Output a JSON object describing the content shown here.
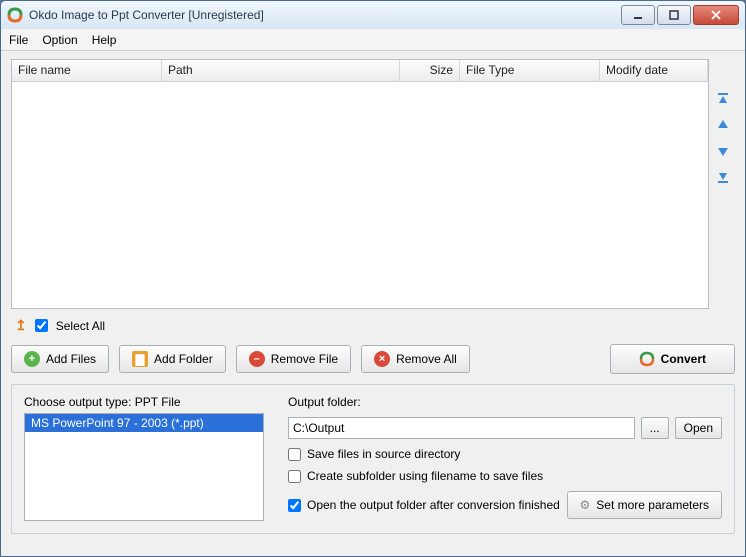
{
  "window": {
    "title": "Okdo Image to Ppt Converter [Unregistered]"
  },
  "menu": {
    "file": "File",
    "option": "Option",
    "help": "Help"
  },
  "columns": {
    "filename": "File name",
    "path": "Path",
    "size": "Size",
    "filetype": "File Type",
    "modify": "Modify date"
  },
  "selectAll": {
    "label": "Select All",
    "checked": true
  },
  "actions": {
    "addFiles": "Add Files",
    "addFolder": "Add Folder",
    "removeFile": "Remove File",
    "removeAll": "Remove All",
    "convert": "Convert"
  },
  "output": {
    "chooseLabel": "Choose output type:",
    "chooseValue": "PPT File",
    "listSelected": "MS PowerPoint 97 - 2003 (*.ppt)",
    "folderLabel": "Output folder:",
    "folderValue": "C:\\Output",
    "browse": "...",
    "open": "Open",
    "opt1": {
      "label": "Save files in source directory",
      "checked": false
    },
    "opt2": {
      "label": "Create subfolder using filename to save files",
      "checked": false
    },
    "opt3": {
      "label": "Open the output folder after conversion finished",
      "checked": true
    },
    "more": "Set more parameters"
  }
}
